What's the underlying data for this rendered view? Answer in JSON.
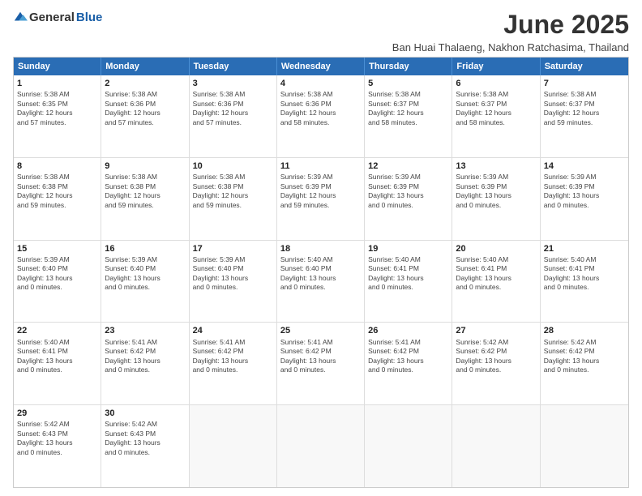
{
  "logo": {
    "general": "General",
    "blue": "Blue"
  },
  "title": "June 2025",
  "location": "Ban Huai Thalaeng, Nakhon Ratchasima, Thailand",
  "days": [
    "Sunday",
    "Monday",
    "Tuesday",
    "Wednesday",
    "Thursday",
    "Friday",
    "Saturday"
  ],
  "weeks": [
    [
      {
        "day": "1",
        "sunrise": "Sunrise: 5:38 AM",
        "sunset": "Sunset: 6:35 PM",
        "daylight": "Daylight: 12 hours",
        "minutes": "and 57 minutes."
      },
      {
        "day": "2",
        "sunrise": "Sunrise: 5:38 AM",
        "sunset": "Sunset: 6:36 PM",
        "daylight": "Daylight: 12 hours",
        "minutes": "and 57 minutes."
      },
      {
        "day": "3",
        "sunrise": "Sunrise: 5:38 AM",
        "sunset": "Sunset: 6:36 PM",
        "daylight": "Daylight: 12 hours",
        "minutes": "and 57 minutes."
      },
      {
        "day": "4",
        "sunrise": "Sunrise: 5:38 AM",
        "sunset": "Sunset: 6:36 PM",
        "daylight": "Daylight: 12 hours",
        "minutes": "and 58 minutes."
      },
      {
        "day": "5",
        "sunrise": "Sunrise: 5:38 AM",
        "sunset": "Sunset: 6:37 PM",
        "daylight": "Daylight: 12 hours",
        "minutes": "and 58 minutes."
      },
      {
        "day": "6",
        "sunrise": "Sunrise: 5:38 AM",
        "sunset": "Sunset: 6:37 PM",
        "daylight": "Daylight: 12 hours",
        "minutes": "and 58 minutes."
      },
      {
        "day": "7",
        "sunrise": "Sunrise: 5:38 AM",
        "sunset": "Sunset: 6:37 PM",
        "daylight": "Daylight: 12 hours",
        "minutes": "and 59 minutes."
      }
    ],
    [
      {
        "day": "8",
        "sunrise": "Sunrise: 5:38 AM",
        "sunset": "Sunset: 6:38 PM",
        "daylight": "Daylight: 12 hours",
        "minutes": "and 59 minutes."
      },
      {
        "day": "9",
        "sunrise": "Sunrise: 5:38 AM",
        "sunset": "Sunset: 6:38 PM",
        "daylight": "Daylight: 12 hours",
        "minutes": "and 59 minutes."
      },
      {
        "day": "10",
        "sunrise": "Sunrise: 5:38 AM",
        "sunset": "Sunset: 6:38 PM",
        "daylight": "Daylight: 12 hours",
        "minutes": "and 59 minutes."
      },
      {
        "day": "11",
        "sunrise": "Sunrise: 5:39 AM",
        "sunset": "Sunset: 6:39 PM",
        "daylight": "Daylight: 12 hours",
        "minutes": "and 59 minutes."
      },
      {
        "day": "12",
        "sunrise": "Sunrise: 5:39 AM",
        "sunset": "Sunset: 6:39 PM",
        "daylight": "Daylight: 13 hours",
        "minutes": "and 0 minutes."
      },
      {
        "day": "13",
        "sunrise": "Sunrise: 5:39 AM",
        "sunset": "Sunset: 6:39 PM",
        "daylight": "Daylight: 13 hours",
        "minutes": "and 0 minutes."
      },
      {
        "day": "14",
        "sunrise": "Sunrise: 5:39 AM",
        "sunset": "Sunset: 6:39 PM",
        "daylight": "Daylight: 13 hours",
        "minutes": "and 0 minutes."
      }
    ],
    [
      {
        "day": "15",
        "sunrise": "Sunrise: 5:39 AM",
        "sunset": "Sunset: 6:40 PM",
        "daylight": "Daylight: 13 hours",
        "minutes": "and 0 minutes."
      },
      {
        "day": "16",
        "sunrise": "Sunrise: 5:39 AM",
        "sunset": "Sunset: 6:40 PM",
        "daylight": "Daylight: 13 hours",
        "minutes": "and 0 minutes."
      },
      {
        "day": "17",
        "sunrise": "Sunrise: 5:39 AM",
        "sunset": "Sunset: 6:40 PM",
        "daylight": "Daylight: 13 hours",
        "minutes": "and 0 minutes."
      },
      {
        "day": "18",
        "sunrise": "Sunrise: 5:40 AM",
        "sunset": "Sunset: 6:40 PM",
        "daylight": "Daylight: 13 hours",
        "minutes": "and 0 minutes."
      },
      {
        "day": "19",
        "sunrise": "Sunrise: 5:40 AM",
        "sunset": "Sunset: 6:41 PM",
        "daylight": "Daylight: 13 hours",
        "minutes": "and 0 minutes."
      },
      {
        "day": "20",
        "sunrise": "Sunrise: 5:40 AM",
        "sunset": "Sunset: 6:41 PM",
        "daylight": "Daylight: 13 hours",
        "minutes": "and 0 minutes."
      },
      {
        "day": "21",
        "sunrise": "Sunrise: 5:40 AM",
        "sunset": "Sunset: 6:41 PM",
        "daylight": "Daylight: 13 hours",
        "minutes": "and 0 minutes."
      }
    ],
    [
      {
        "day": "22",
        "sunrise": "Sunrise: 5:40 AM",
        "sunset": "Sunset: 6:41 PM",
        "daylight": "Daylight: 13 hours",
        "minutes": "and 0 minutes."
      },
      {
        "day": "23",
        "sunrise": "Sunrise: 5:41 AM",
        "sunset": "Sunset: 6:42 PM",
        "daylight": "Daylight: 13 hours",
        "minutes": "and 0 minutes."
      },
      {
        "day": "24",
        "sunrise": "Sunrise: 5:41 AM",
        "sunset": "Sunset: 6:42 PM",
        "daylight": "Daylight: 13 hours",
        "minutes": "and 0 minutes."
      },
      {
        "day": "25",
        "sunrise": "Sunrise: 5:41 AM",
        "sunset": "Sunset: 6:42 PM",
        "daylight": "Daylight: 13 hours",
        "minutes": "and 0 minutes."
      },
      {
        "day": "26",
        "sunrise": "Sunrise: 5:41 AM",
        "sunset": "Sunset: 6:42 PM",
        "daylight": "Daylight: 13 hours",
        "minutes": "and 0 minutes."
      },
      {
        "day": "27",
        "sunrise": "Sunrise: 5:42 AM",
        "sunset": "Sunset: 6:42 PM",
        "daylight": "Daylight: 13 hours",
        "minutes": "and 0 minutes."
      },
      {
        "day": "28",
        "sunrise": "Sunrise: 5:42 AM",
        "sunset": "Sunset: 6:42 PM",
        "daylight": "Daylight: 13 hours",
        "minutes": "and 0 minutes."
      }
    ],
    [
      {
        "day": "29",
        "sunrise": "Sunrise: 5:42 AM",
        "sunset": "Sunset: 6:43 PM",
        "daylight": "Daylight: 13 hours",
        "minutes": "and 0 minutes."
      },
      {
        "day": "30",
        "sunrise": "Sunrise: 5:42 AM",
        "sunset": "Sunset: 6:43 PM",
        "daylight": "Daylight: 13 hours",
        "minutes": "and 0 minutes."
      },
      {
        "day": "",
        "sunrise": "",
        "sunset": "",
        "daylight": "",
        "minutes": ""
      },
      {
        "day": "",
        "sunrise": "",
        "sunset": "",
        "daylight": "",
        "minutes": ""
      },
      {
        "day": "",
        "sunrise": "",
        "sunset": "",
        "daylight": "",
        "minutes": ""
      },
      {
        "day": "",
        "sunrise": "",
        "sunset": "",
        "daylight": "",
        "minutes": ""
      },
      {
        "day": "",
        "sunrise": "",
        "sunset": "",
        "daylight": "",
        "minutes": ""
      }
    ]
  ]
}
